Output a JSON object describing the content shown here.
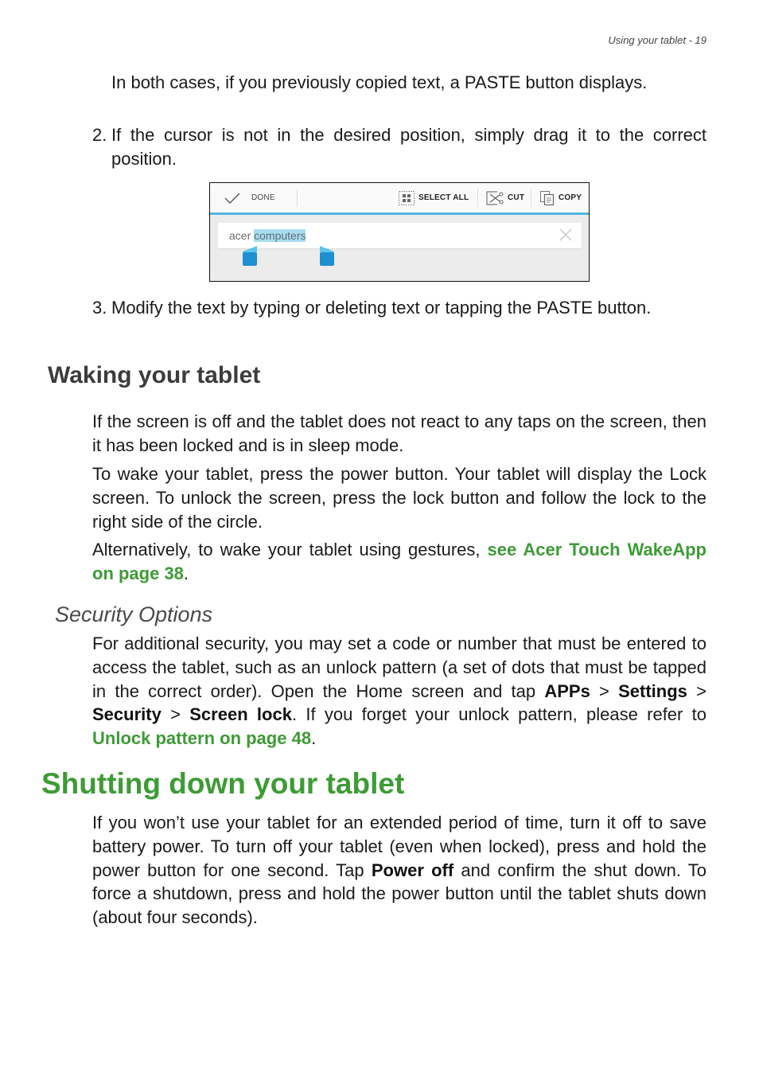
{
  "header": {
    "running_title": "Using your tablet - 19"
  },
  "steps": {
    "continuation": "In both cases, if you previously copied text, a PASTE button displays.",
    "step2": {
      "number": "2.",
      "text": "If the cursor is not in the desired position, simply drag it to the correct position."
    },
    "step3": {
      "number": "3.",
      "text": "Modify the text by typing or deleting text or tapping the PASTE button."
    }
  },
  "figure": {
    "action_bar": {
      "done_label": "DONE",
      "select_all_label": "SELECT ALL",
      "cut_label": "CUT",
      "copy_label": "COPY",
      "accent_color": "#52b7df"
    },
    "text_field": {
      "unselected_text": "acer ",
      "selected_text": "computers",
      "selection_color": "#a9dcef",
      "handle_color": "#1e8fd0"
    }
  },
  "waking": {
    "heading": "Waking your tablet",
    "p1": "If the screen is off and the tablet does not react to any taps on the screen, then it has been locked and is in sleep mode.",
    "p2": "To wake your tablet, press the power button. Your tablet will display the Lock screen. To unlock the screen, press the lock button and follow the lock to the right side of the circle.",
    "p3_before": "Alternatively, to wake your tablet using gestures, ",
    "p3_link": "see Acer Touch WakeApp on page 38",
    "p3_after": "."
  },
  "security": {
    "heading": "Security Options",
    "p_before": "For additional security, you may set a code or number that must be entered to access the tablet, such as an unlock pattern (a set of dots that must be tapped in the correct order). Open the Home screen and tap ",
    "apps": "APPs",
    "sep": " > ",
    "settings": "Settings",
    "security": "Security",
    "screen_lock": "Screen lock",
    "p_mid": ". If you forget your unlock pattern, please refer to ",
    "link": "Unlock pattern on page 48",
    "p_end": "."
  },
  "shutdown": {
    "heading": "Shutting down your tablet",
    "p_before": "If you won’t use your tablet for an extended period of time, turn it off to save battery power. To turn off your tablet (even when locked), press and hold the power button for one second. Tap ",
    "power_off": "Power off",
    "p_after": " and confirm the shut down. To force a shutdown, press and hold the power button until the tablet shuts down (about four seconds)."
  },
  "colors": {
    "link_green": "#3d9b35",
    "heading_gray": "#3c3c3c"
  }
}
